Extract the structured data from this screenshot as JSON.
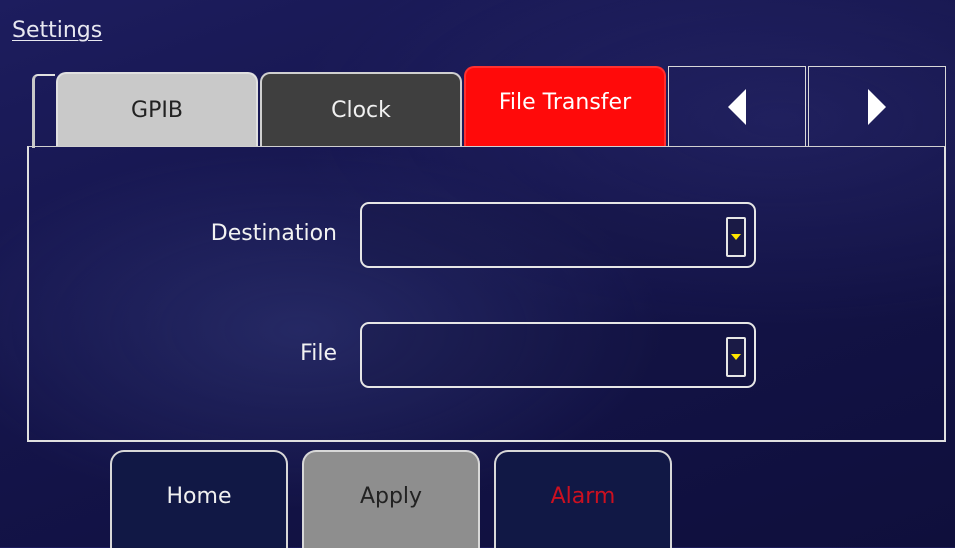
{
  "header": {
    "title": "Settings"
  },
  "tabs": [
    {
      "label": "GPIB",
      "state": "inactive"
    },
    {
      "label": "Clock",
      "state": "inactive"
    },
    {
      "label": "File Transfer",
      "state": "active"
    }
  ],
  "tab_nav": {
    "prev_icon": "triangle-left-icon",
    "next_icon": "triangle-right-icon"
  },
  "form": {
    "destination": {
      "label": "Destination",
      "value": ""
    },
    "file": {
      "label": "File",
      "value": ""
    }
  },
  "footer": {
    "home_label": "Home",
    "apply_label": "Apply",
    "alarm_label": "Alarm"
  },
  "colors": {
    "background": "#14144a",
    "active_tab": "#ff0a0a",
    "dropdown_arrow": "#ffe600",
    "alarm_text": "#cc1020"
  }
}
